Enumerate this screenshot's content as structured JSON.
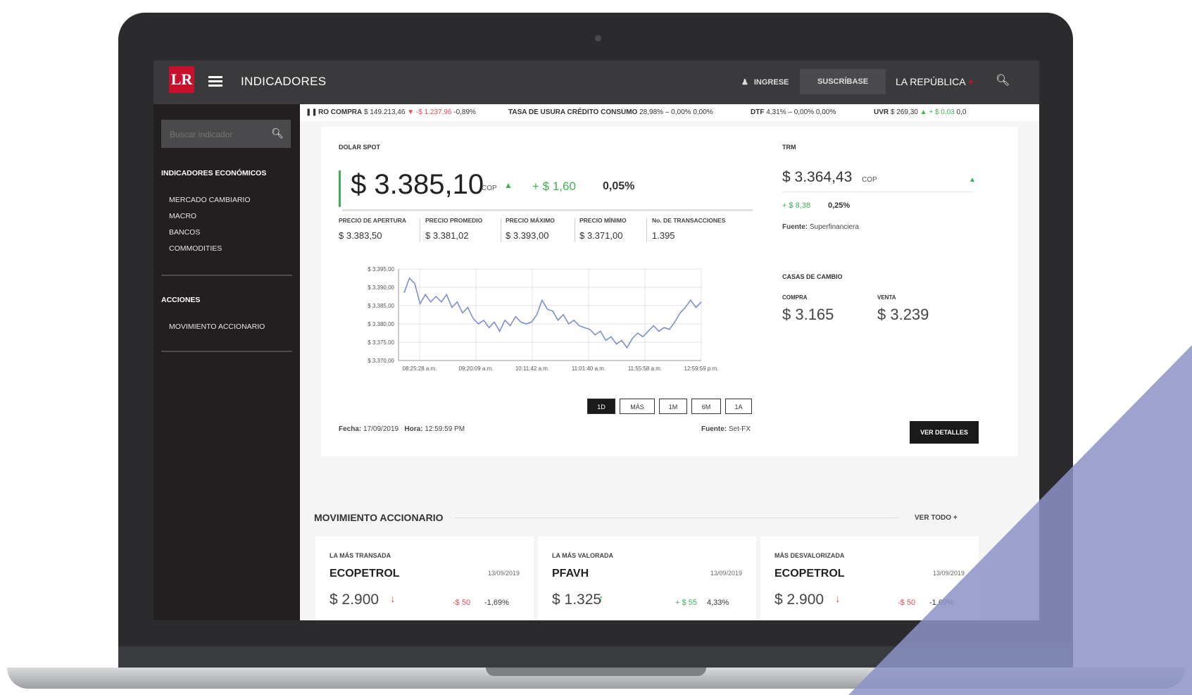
{
  "header": {
    "logo": "LR",
    "title": "INDICADORES",
    "login": "INGRESE",
    "subscribe": "SUSCRÍBASE",
    "brand": "LA REPÚBLICA",
    "brand_plus": "+"
  },
  "sidebar": {
    "search_placeholder": "Buscar indicador",
    "section_economic": "INDICADORES ECONÓMICOS",
    "economic_items": [
      "MERCADO CAMBIARIO",
      "MACRO",
      "BANCOS",
      "COMMODITIES"
    ],
    "section_actions": "ACCIONES",
    "action_items": [
      "MOVIMIENTO ACCIONARIO"
    ]
  },
  "ticker": [
    {
      "label": "RO COMPRA",
      "value": "$ 149.213,46",
      "change": "-$ 1.237,96",
      "pct": "-0,89%",
      "direction": "down"
    },
    {
      "label": "TASA DE USURA CRÉDITO CONSUMO",
      "value": "28,98%",
      "change": "0,00%",
      "pct": "0,00%",
      "direction": "flat"
    },
    {
      "label": "DTF",
      "value": "4,31%",
      "change": "0,00%",
      "pct": "0,00%",
      "direction": "flat"
    },
    {
      "label": "UVR",
      "value": "$ 269,30",
      "change": "+ $ 0,03",
      "pct": "0,0",
      "direction": "up"
    }
  ],
  "dolar": {
    "label": "DOLAR SPOT",
    "price": "$ 3.385,10",
    "currency": "COP",
    "change": "+ $ 1,60",
    "pct": "0,05%",
    "stats": [
      {
        "label": "PRECIO DE APERTURA",
        "value": "$ 3.383,50"
      },
      {
        "label": "PRECIO PROMEDIO",
        "value": "$ 3.381,02"
      },
      {
        "label": "PRECIO MÁXIMO",
        "value": "$ 3.393,00"
      },
      {
        "label": "PRECIO MÍNIMO",
        "value": "$ 3.371,00"
      },
      {
        "label": "No. DE TRANSACCIONES",
        "value": "1.395"
      }
    ],
    "ranges": [
      "1D",
      "MÁS",
      "1M",
      "6M",
      "1A"
    ],
    "active_range": "1D",
    "date_label": "Fecha:",
    "date": "17/09/2019",
    "time_label": "Hora:",
    "time": "12:59:59 PM",
    "source_label": "Fuente:",
    "source": "Set-FX",
    "detail_button": "VER DETALLES"
  },
  "chart_data": {
    "type": "line",
    "ylim": [
      3370,
      3395
    ],
    "yticks": [
      "$ 3.395,00",
      "$ 3.390,00",
      "$ 3.385,00",
      "$ 3.380,00",
      "$ 3.375,00",
      "$ 3.370,00"
    ],
    "xticks": [
      "08:25:28 a.m.",
      "09:20:09 a.m.",
      "10:11:42 a.m.",
      "11:01:40 a.m.",
      "11:55:58 a.m.",
      "12:59:59 p.m."
    ],
    "series": [
      {
        "values": [
          3388.5,
          3392.5,
          3391,
          3385.5,
          3388,
          3386,
          3387.5,
          3386,
          3388,
          3384.5,
          3386,
          3383,
          3384.5,
          3381.5,
          3380,
          3381,
          3379,
          3380.5,
          3378,
          3381,
          3379.5,
          3382,
          3380.5,
          3380,
          3380.5,
          3382.5,
          3386.5,
          3384,
          3383.5,
          3381,
          3382.5,
          3380,
          3381,
          3379.5,
          3379,
          3378.5,
          3377,
          3378,
          3375.5,
          3376.5,
          3374.5,
          3375.5,
          3373.5,
          3376,
          3377.5,
          3376.5,
          3378,
          3379.5,
          3378,
          3379,
          3378.5,
          3380.5,
          3383,
          3384.5,
          3386.5,
          3384.5,
          3386
        ]
      }
    ],
    "grid": true,
    "color": "#7b8fd0"
  },
  "trm": {
    "label": "TRM",
    "price": "$ 3.364,43",
    "currency": "COP",
    "change": "+ $ 8,38",
    "pct": "0,25%",
    "source_label": "Fuente:",
    "source": "Superfinanciera"
  },
  "casas": {
    "label": "CASAS DE CAMBIO",
    "buy_label": "COMPRA",
    "buy": "$ 3.165",
    "sell_label": "VENTA",
    "sell": "$ 3.239"
  },
  "acciones": {
    "title": "MOVIMIENTO ACCIONARIO",
    "see_all": "VER TODO",
    "cards": [
      {
        "category": "LA MÁS TRANSADA",
        "name": "ECOPETROL",
        "date": "13/09/2019",
        "price": "$ 2.900",
        "change": "-$ 50",
        "pct": "-1,69%",
        "direction": "down"
      },
      {
        "category": "LA MÁS VALORADA",
        "name": "PFAVH",
        "date": "13/09/2019",
        "price": "$ 1.325",
        "change": "+ $ 55",
        "pct": "4,33%",
        "direction": "up"
      },
      {
        "category": "MÁS DESVALORIZADA",
        "name": "ECOPETROL",
        "date": "13/09/2019",
        "price": "$ 2.900",
        "change": "-$ 50",
        "pct": "-1,69%",
        "direction": "down"
      }
    ]
  },
  "colors": {
    "brand_red": "#c8102e",
    "up_green": "#41b053",
    "down_red": "#e8474e",
    "sidebar_bg": "#231f20",
    "topbar_bg": "#3a3a3c",
    "triangle": "#8c93c6"
  }
}
